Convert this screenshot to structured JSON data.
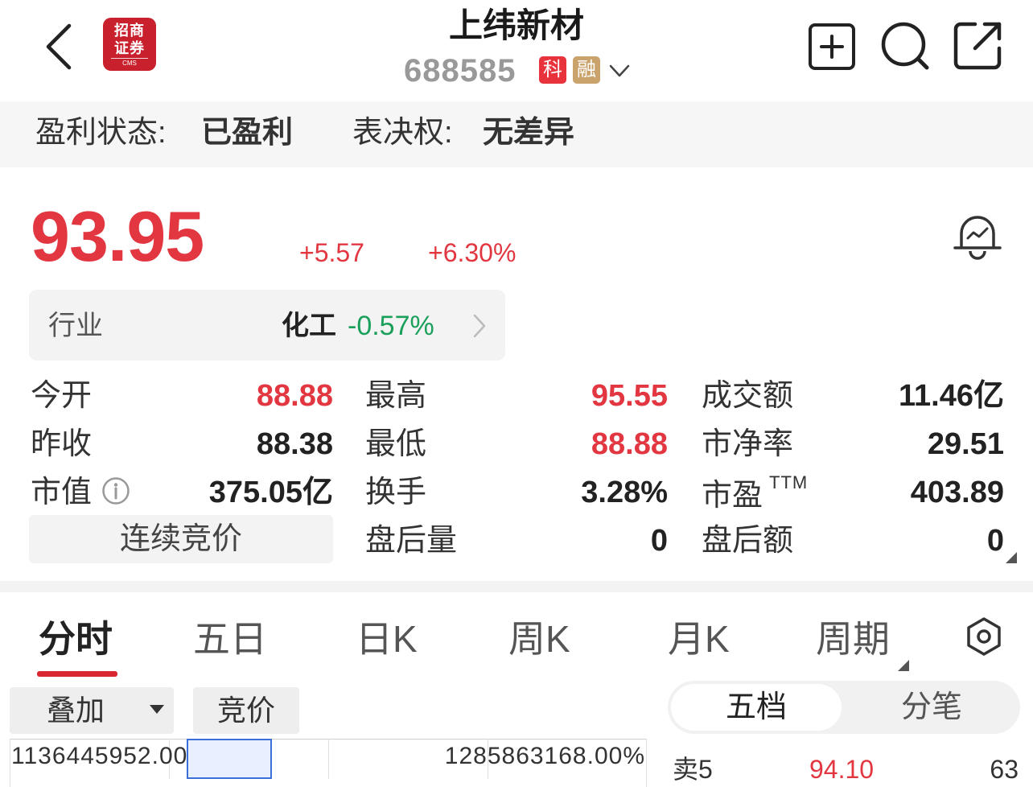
{
  "header": {
    "back_icon": "chevron-left-icon",
    "logo": {
      "line1": "招商",
      "line2": "证券",
      "sub": "CMS",
      "color": "#c8202c"
    },
    "stock_name": "上纬新材",
    "stock_code": "688585",
    "tag_star": "科",
    "tag_margin": "融",
    "actions": [
      "add-watchlist-icon",
      "search-icon",
      "share-icon"
    ]
  },
  "status": {
    "profit_label": "盈利状态:",
    "profit_value": "已盈利",
    "vote_label": "表决权:",
    "vote_value": "无差异"
  },
  "quote": {
    "price": "93.95",
    "change": "+5.57",
    "change_pct": "+6.30%",
    "up_color": "#e23741",
    "down_color": "#1aa05a"
  },
  "industry": {
    "label": "行业",
    "name": "化工",
    "change": "-0.57%"
  },
  "stats": {
    "open_label": "今开",
    "open": "88.88",
    "high_label": "最高",
    "high": "95.55",
    "turnover_amt_label": "成交额",
    "turnover_amt": "11.46亿",
    "prev_close_label": "昨收",
    "prev_close": "88.38",
    "low_label": "最低",
    "low": "88.88",
    "pb_label": "市净率",
    "pb": "29.51",
    "mktcap_label": "市值",
    "mktcap": "375.05亿",
    "turnover_rate_label": "换手",
    "turnover_rate": "3.28%",
    "pe_label": "市盈",
    "pe_sup": "TTM",
    "pe": "403.89",
    "auction_label": "连续竞价",
    "after_vol_label": "盘后量",
    "after_vol": "0",
    "after_amt_label": "盘后额",
    "after_amt": "0"
  },
  "tabs": {
    "items": [
      "分时",
      "五日",
      "日K",
      "周K",
      "月K",
      "周期"
    ],
    "active": "分时",
    "settings_icon": "hexagon-settings-icon"
  },
  "chart_controls": {
    "overlay": "叠加",
    "auction": "竞价",
    "axis_left": "1136445952.00",
    "axis_right": "1285863168.00%"
  },
  "orderbook": {
    "tab_five": "五档",
    "tab_ticks": "分笔",
    "rows": [
      {
        "label": "卖5",
        "price": "94.10",
        "volume": "63"
      }
    ]
  }
}
